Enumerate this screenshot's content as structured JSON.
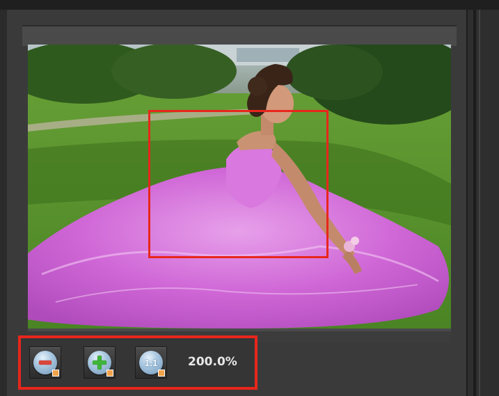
{
  "zoom": {
    "out_icon": "zoom-out-icon",
    "in_icon": "zoom-in-icon",
    "actual_size_label": "1:1",
    "level_text": "200.0%"
  },
  "colors": {
    "highlight": "#e8261c",
    "panel_bg": "#3a3a3a",
    "dress": "#d36ad8",
    "grass": "#4f8a2a"
  }
}
